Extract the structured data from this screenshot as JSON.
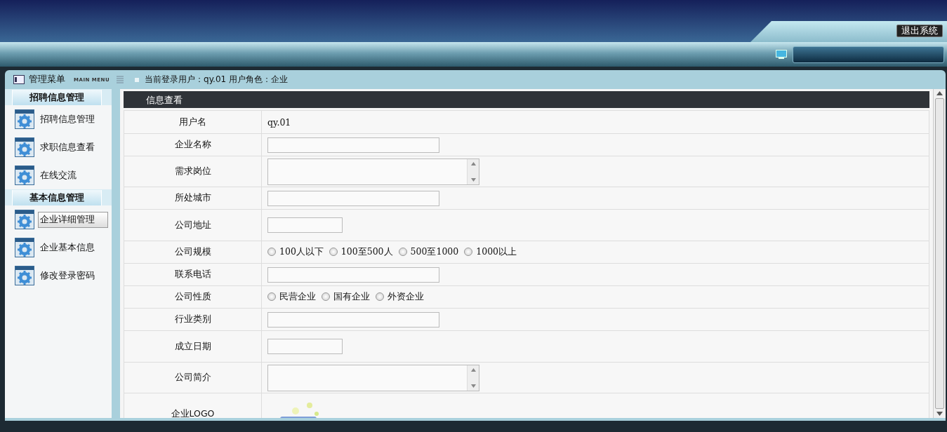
{
  "header": {
    "logout_button": "退出系统"
  },
  "menu": {
    "title": "管理菜单",
    "subtitle": "MAIN MENU",
    "groups": [
      {
        "title": "招聘信息管理",
        "items": [
          {
            "label": "招聘信息管理",
            "selected": false
          },
          {
            "label": "求职信息查看",
            "selected": false
          },
          {
            "label": "在线交流",
            "selected": false
          }
        ]
      },
      {
        "title": "基本信息管理",
        "items": [
          {
            "label": "企业详细管理",
            "selected": true
          },
          {
            "label": "企业基本信息",
            "selected": false
          },
          {
            "label": "修改登录密码",
            "selected": false
          }
        ]
      }
    ]
  },
  "status": {
    "user_label": "当前登录用户：",
    "user": "qy.01",
    "role_label": "用户角色：",
    "role": "企业"
  },
  "form": {
    "title": "信息查看",
    "rows": [
      {
        "label": "用户名",
        "kind": "text",
        "value": "qy.01"
      },
      {
        "label": "企业名称",
        "kind": "input"
      },
      {
        "label": "需求岗位",
        "kind": "textarea"
      },
      {
        "label": "所处城市",
        "kind": "input"
      },
      {
        "label": "公司地址",
        "kind": "short-input"
      },
      {
        "label": "公司规模",
        "kind": "radio",
        "options": [
          {
            "label": "100人以下",
            "selected": false
          },
          {
            "label": "100至500人",
            "selected": false
          },
          {
            "label": "500至1000",
            "selected": false
          },
          {
            "label": "1000以上",
            "selected": false
          }
        ]
      },
      {
        "label": "联系电话",
        "kind": "input"
      },
      {
        "label": "公司性质",
        "kind": "radio",
        "options": [
          {
            "label": "民营企业",
            "selected": false
          },
          {
            "label": "国有企业",
            "selected": false
          },
          {
            "label": "外资企业",
            "selected": false
          }
        ]
      },
      {
        "label": "行业类别",
        "kind": "input"
      },
      {
        "label": "成立日期",
        "kind": "short-input"
      },
      {
        "label": "公司简介",
        "kind": "textarea"
      },
      {
        "label": "企业LOGO",
        "kind": "picture"
      }
    ]
  }
}
